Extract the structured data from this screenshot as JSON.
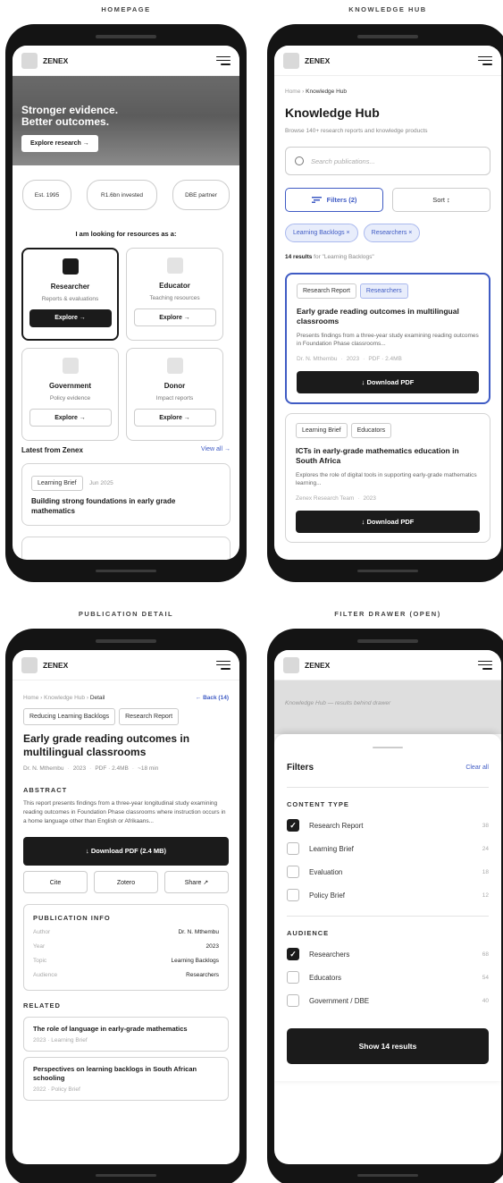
{
  "labels": {
    "homepage": "HOMEPAGE",
    "hub": "KNOWLEDGE HUB",
    "detail": "PUBLICATION DETAIL",
    "drawer": "FILTER DRAWER (OPEN)"
  },
  "brand": "ZENEX",
  "home": {
    "hero_line1": "Stronger evidence.",
    "hero_line2": "Better outcomes.",
    "hero_button": "Explore research →",
    "pills": [
      "Est. 1995",
      "R1.6bn invested",
      "DBE partner"
    ],
    "looking_title": "I am looking for resources as a:",
    "cards": [
      {
        "title": "Researcher",
        "sub": "Reports & evaluations",
        "button": "Explore →"
      },
      {
        "title": "Educator",
        "sub": "Teaching resources",
        "button": "Explore →"
      },
      {
        "title": "Government",
        "sub": "Policy evidence",
        "button": "Explore →"
      },
      {
        "title": "Donor",
        "sub": "Impact reports",
        "button": "Explore →"
      }
    ],
    "latest_title": "Latest from Zenex",
    "view_all": "View all →",
    "latest_tag": "Learning Brief",
    "latest_date": "Jun 2025",
    "latest_item": "Building strong foundations in early grade mathematics"
  },
  "hub": {
    "crumb_home": "Home",
    "crumb_current": "Knowledge Hub",
    "title": "Knowledge Hub",
    "subtitle": "Browse 140+ research reports and knowledge products",
    "search_placeholder": "Search publications...",
    "filters_button": "Filters (2)",
    "sort_button": "Sort ↕",
    "chips": [
      "Learning Backlogs ×",
      "Researchers ×"
    ],
    "results_count": "14 results",
    "results_for": " for \"Learning Backlogs\"",
    "pubs": [
      {
        "tags": [
          "Research Report",
          "Researchers"
        ],
        "title": "Early grade reading outcomes in multilingual classrooms",
        "desc": "Presents findings from a three-year study examining reading outcomes in Foundation Phase classrooms...",
        "author": "Dr. N. Mthembu",
        "year": "2023",
        "format": "PDF · 2.4MB",
        "button": "↓ Download PDF"
      },
      {
        "tags": [
          "Learning Brief",
          "Educators"
        ],
        "title": "ICTs in early-grade mathematics education in South Africa",
        "desc": "Explores the role of digital tools in supporting early-grade mathematics learning...",
        "author": "Zenex Research Team",
        "year": "2023",
        "button": "↓ Download PDF"
      }
    ]
  },
  "detail": {
    "crumb_home": "Home",
    "crumb_hub": "Knowledge Hub",
    "crumb_current": "Detail",
    "back": "← Back (14)",
    "tags": [
      "Reducing Learning Backlogs",
      "Research Report"
    ],
    "title": "Early grade reading outcomes in multilingual classrooms",
    "author": "Dr. N. Mthembu",
    "year": "2023",
    "format": "PDF · 2.4MB",
    "read": "~18 min",
    "abstract_head": "ABSTRACT",
    "abstract": "This report presents findings from a three-year longitudinal study examining reading outcomes in Foundation Phase classrooms where instruction occurs in a home language other than English or Afrikaans...",
    "download": "↓ Download PDF (2.4 MB)",
    "actions": [
      "Cite",
      "Zotero",
      "Share ↗"
    ],
    "info_head": "PUBLICATION INFO",
    "info": [
      {
        "k": "Author",
        "v": "Dr. N. Mthembu"
      },
      {
        "k": "Year",
        "v": "2023"
      },
      {
        "k": "Topic",
        "v": "Learning Backlogs"
      },
      {
        "k": "Audience",
        "v": "Researchers"
      }
    ],
    "related_head": "RELATED",
    "related": [
      {
        "title": "The role of language in early-grade mathematics",
        "sub": "2023 · Learning Brief"
      },
      {
        "title": "Perspectives on learning backlogs in South African schooling",
        "sub": "2022 · Policy Brief"
      }
    ]
  },
  "drawer": {
    "behind_text": "Knowledge Hub — results behind drawer",
    "title": "Filters",
    "clear": "Clear all",
    "content_type_head": "CONTENT TYPE",
    "content_types": [
      {
        "label": "Research Report",
        "count": "38",
        "checked": true
      },
      {
        "label": "Learning Brief",
        "count": "24",
        "checked": false
      },
      {
        "label": "Evaluation",
        "count": "18",
        "checked": false
      },
      {
        "label": "Policy Brief",
        "count": "12",
        "checked": false
      }
    ],
    "audience_head": "AUDIENCE",
    "audiences": [
      {
        "label": "Researchers",
        "count": "68",
        "checked": true
      },
      {
        "label": "Educators",
        "count": "54",
        "checked": false
      },
      {
        "label": "Government / DBE",
        "count": "40",
        "checked": false
      }
    ],
    "check_glyph": "✓",
    "show_button": "Show 14 results"
  }
}
